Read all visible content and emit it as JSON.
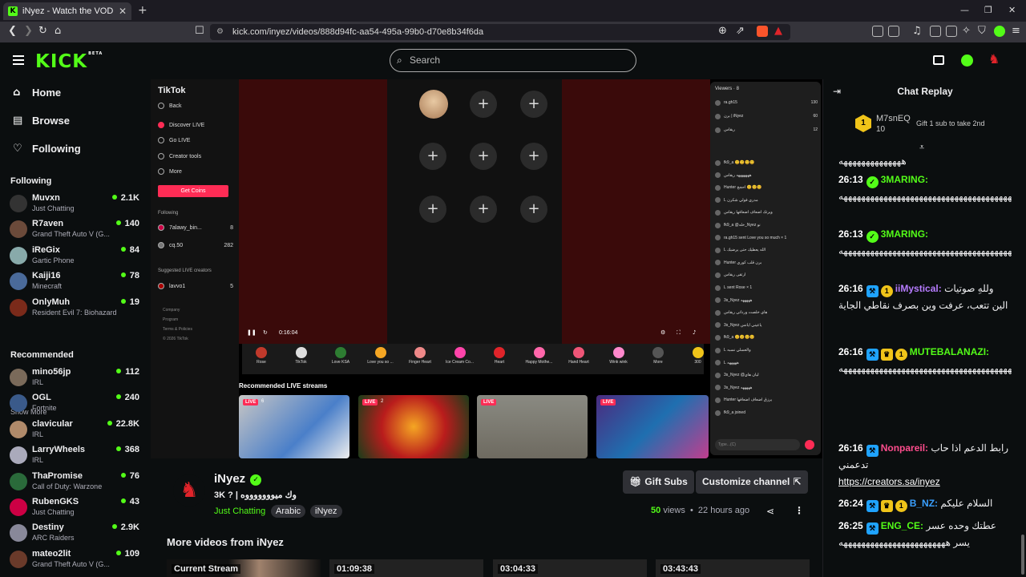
{
  "browser": {
    "tab_title": "iNyez - Watch the VOD on Kick",
    "url": "kick.com/inyez/videos/888d94fc-aa54-495a-99b0-d70e8b34f6da"
  },
  "header": {
    "logo": "KICK",
    "logo_badge": "BETA",
    "search_placeholder": "Search"
  },
  "sidebar": {
    "nav": [
      {
        "label": "Home",
        "icon": "home-icon"
      },
      {
        "label": "Browse",
        "icon": "browse-icon"
      },
      {
        "label": "Following",
        "icon": "heart-icon"
      }
    ],
    "following_title": "Following",
    "following": [
      {
        "name": "Muvxn",
        "category": "Just Chatting",
        "viewers": "2.1K"
      },
      {
        "name": "R7aven",
        "category": "Grand Theft Auto V (G...",
        "viewers": "140"
      },
      {
        "name": "iReGix",
        "category": "Gartic Phone",
        "viewers": "84"
      },
      {
        "name": "Kaiji16",
        "category": "Minecraft",
        "viewers": "78"
      },
      {
        "name": "OnlyMuh",
        "category": "Resident Evil 7: Biohazard",
        "viewers": "19"
      }
    ],
    "show_more": "Show More",
    "recommended_title": "Recommended",
    "recommended": [
      {
        "name": "mino56jp",
        "category": "IRL",
        "viewers": "112"
      },
      {
        "name": "OGL",
        "category": "Fortnite",
        "viewers": "240"
      },
      {
        "name": "clavicular",
        "category": "IRL",
        "viewers": "22.8K"
      },
      {
        "name": "LarryWheels",
        "category": "IRL",
        "viewers": "368"
      },
      {
        "name": "ThaPromise",
        "category": "Call of Duty: Warzone",
        "viewers": "76"
      },
      {
        "name": "RubenGKS",
        "category": "Just Chatting",
        "viewers": "43"
      },
      {
        "name": "Destiny",
        "category": "ARC Raiders",
        "viewers": "2.9K"
      },
      {
        "name": "mateo2lit",
        "category": "Grand Theft Auto V (G...",
        "viewers": "109"
      }
    ]
  },
  "player": {
    "tiktok": {
      "brand": "TikTok",
      "back": "Back",
      "menu": [
        "Discover LIVE",
        "Go LIVE",
        "Creator tools",
        "More"
      ],
      "get_coins": "Get Coins",
      "following_label": "Following",
      "following": [
        {
          "name": "7alawy_bin...",
          "count": "8"
        },
        {
          "name": "cq.50",
          "count": "282"
        }
      ],
      "suggested_label": "Suggested LIVE creators",
      "suggested": [
        {
          "name": "lavvo1",
          "count": "5"
        }
      ],
      "footer": [
        "Company",
        "Program",
        "Terms & Policies",
        "© 2026 TikTok"
      ],
      "time": "0:16:04",
      "gifts": [
        "Rose",
        "TikTok",
        "Love KSA",
        "Love you so ...",
        "Finger Heart",
        "Ice Cream Co...",
        "Heart",
        "Happy Mothe...",
        "Hand Heart",
        "Wink wink",
        "More",
        "300"
      ],
      "recommended_label": "Recommended LIVE streams",
      "streams": [
        {
          "live": "LIVE",
          "viewers": "6"
        },
        {
          "live": "LIVE",
          "viewers": "2"
        },
        {
          "live": "LIVE",
          "viewers": ""
        },
        {
          "live": "LIVE",
          "viewers": ""
        }
      ],
      "viewers_label": "Viewers · 8",
      "chat_input": "Type...(C)",
      "chat_rows": [
        {
          "user": "ra.gh15",
          "text": "",
          "count": "130"
        },
        {
          "user": "برن | iNyez",
          "text": "",
          "count": "60"
        },
        {
          "user": "ريقاس",
          "text": "",
          "count": "12"
        },
        {
          "user": "fk9_a",
          "text": "😊😊😊😊"
        },
        {
          "user": "ريقاس",
          "text": "هههههههه"
        },
        {
          "user": "Hunter",
          "text": "احجج 😊😊😊"
        },
        {
          "user": "L",
          "text": "مدري فولي شكرن"
        },
        {
          "user": "ريقاس",
          "text": "ويرتك اضعاف اضعافها"
        },
        {
          "user": "fk9_a",
          "text": "@خله_Nyez نو"
        },
        {
          "user": "ra.gh15",
          "text": "sent Love you so much × 1"
        },
        {
          "user": "L",
          "text": "الله يعطيك حتى يرضيك"
        },
        {
          "user": "Hunter",
          "text": "برن قلب كوري"
        },
        {
          "user": "ريقاس",
          "text": "ارتقى"
        },
        {
          "user": "L",
          "text": "sent Rose × 1"
        },
        {
          "user": "3s_Nyez",
          "text": "هههههه"
        },
        {
          "user": "ريقاس",
          "text": "هاي خلصت ورداتي"
        },
        {
          "user": "3s_Nyez",
          "text": "ياعيني ايانس"
        },
        {
          "user": "fk9_a",
          "text": "😊😊😊😊"
        },
        {
          "user": "L",
          "text": "والعسلي نسبه"
        },
        {
          "user": "L",
          "text": "هههههه"
        },
        {
          "user": "3s_Nyez",
          "text": "@ليان هاي"
        },
        {
          "user": "3s_Nyez",
          "text": "هههههه"
        },
        {
          "user": "Hunter",
          "text": "يرزق اضعاف اضعافها"
        },
        {
          "user": "fk9_a",
          "text": "joined"
        }
      ]
    }
  },
  "video": {
    "channel": "iNyez",
    "title": "3K ? | وك ميوووووووه",
    "category": "Just Chatting",
    "tags": [
      "Arabic",
      "iNyez"
    ],
    "gift_subs": "Gift Subs",
    "customize": "Customize channel",
    "views_num": "50",
    "views_label": "views",
    "ago": "22 hours ago",
    "more_title": "More videos from iNyez",
    "more_videos": [
      "Current Stream",
      "01:09:38",
      "03:04:33",
      "03:43:43"
    ]
  },
  "chat": {
    "title": "Chat Replay",
    "pinned": {
      "user": "M7snEQ",
      "count": "10",
      "badge": "1",
      "message": "Gift 1 sub to take 2nd"
    },
    "messages": [
      {
        "time": "",
        "user": "",
        "color": "#ffffff",
        "text": "ههههههههههههههه"
      },
      {
        "time": "26:13",
        "user": "3MARING:",
        "color": "#53fc18",
        "text": "هههههههههههههههههههههههههههههههههههههههههههههههههههههههه"
      },
      {
        "time": "26:13",
        "user": "3MARING:",
        "color": "#53fc18",
        "text": "هههههههههههههههههههههههههههههههههههههههههههههههههههههههه"
      },
      {
        "time": "26:16",
        "user": "iiMystical:",
        "color": "#b77cff",
        "text": "وللهِ صوتيات الين تتعب، عرفت وين بصرف نقاطي الجاية"
      },
      {
        "time": "26:16",
        "user": "MUTEBALANAZI:",
        "color": "#53fc18",
        "text": "ههههههههههههههههههههههههههههههههههههههههههههههههههههههههههههههههههههههههههههههههه"
      },
      {
        "time": "26:16",
        "user": "Nonpareil:",
        "color": "#ff4d8d",
        "text": "رابط الدعم اذا حاب تدعمني"
      },
      {
        "time": "26:24",
        "user": "B_NZ:",
        "color": "#3aa0ff",
        "text": "السلام عليكم"
      },
      {
        "time": "26:25",
        "user": "ENG_CE:",
        "color": "#53fc18",
        "text": "عطتك وحده عسر يسر ههههههههههههههههههههههههه"
      }
    ],
    "link": "https://creators.sa/inyez"
  }
}
